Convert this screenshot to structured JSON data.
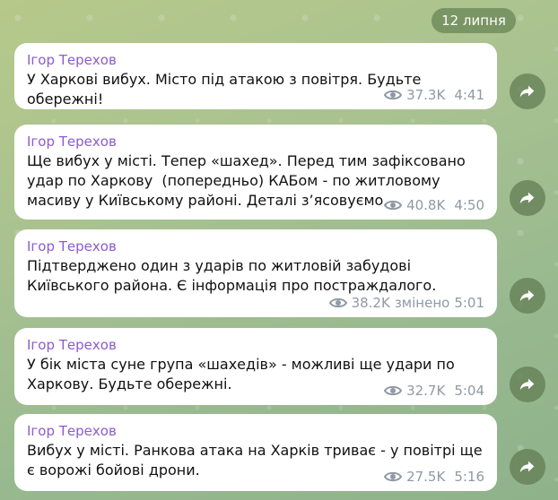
{
  "date_label": "12 липня",
  "messages": [
    {
      "author": "Ігор Терехов",
      "text": "У Харкові вибух. Місто під атакою з повітря. Будьте обережні!",
      "views": "37.3K",
      "edited": "",
      "time": "4:41"
    },
    {
      "author": "Ігор Терехов",
      "text": "Ще вибух у місті. Тепер «шахед». Перед тим зафіксовано удар по Харкову  (попередньо) КАБом - по житловому масиву у Київському районі. Деталі з’ясовуємо.",
      "views": "40.8K",
      "edited": "",
      "time": "4:50"
    },
    {
      "author": "Ігор Терехов",
      "text": "Підтверджено один з ударів по житловій забудові Київського района. Є інформація про постраждалого.",
      "views": "38.2K",
      "edited": "змінено",
      "time": "5:01"
    },
    {
      "author": "Ігор Терехов",
      "text": "У бік міста суне група «шахедів» - можливі ще удари по Харкову. Будьте обережні.",
      "views": "32.7K",
      "edited": "",
      "time": "5:04"
    },
    {
      "author": "Ігор Терехов",
      "text": "Вибух у місті. Ранкова атака на Харків триває - у повітрі ще є ворожі бойові дрони.",
      "views": "27.5K",
      "edited": "",
      "time": "5:16"
    }
  ],
  "icons": {
    "views": "eye-icon",
    "forward": "forward-arrow-icon"
  },
  "colors": {
    "author": "#8b5bd1",
    "meta": "#8f99a4",
    "bubble": "#ffffff"
  }
}
